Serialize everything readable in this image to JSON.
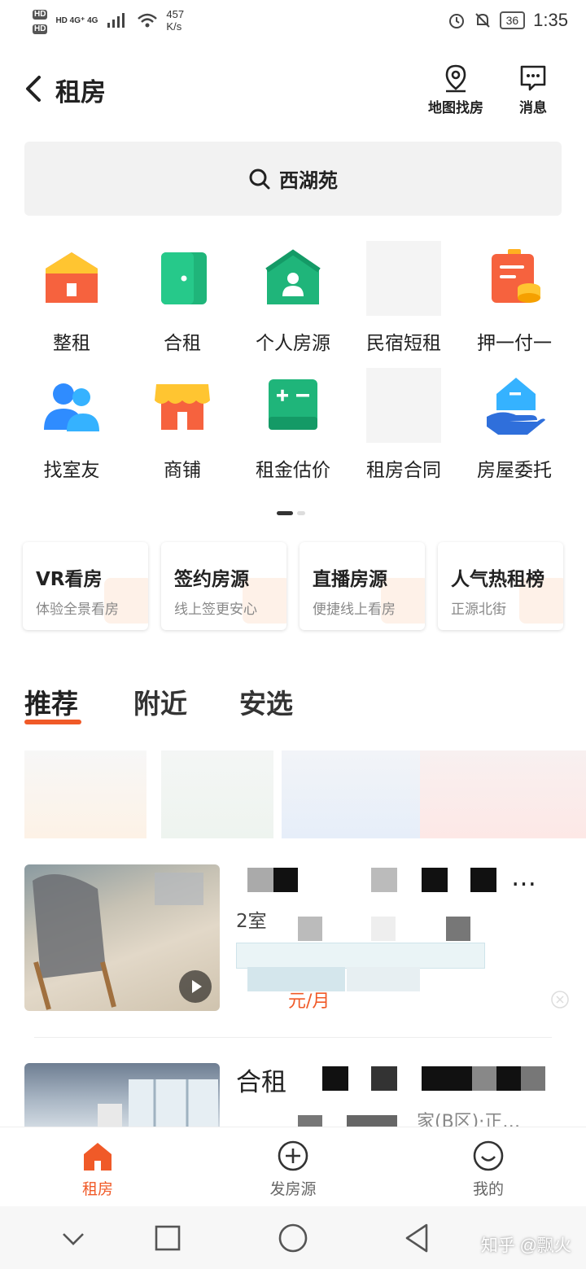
{
  "status_bar": {
    "left_text": "HD 4G⁺ 4G",
    "speed_value": "457",
    "speed_unit": "K/s",
    "battery": "36",
    "time": "1:35"
  },
  "header": {
    "title": "租房",
    "map_label": "地图找房",
    "message_label": "消息"
  },
  "search": {
    "text": "西湖苑"
  },
  "categories": [
    {
      "label": "整租",
      "icon": "house-icon"
    },
    {
      "label": "合租",
      "icon": "door-icon"
    },
    {
      "label": "个人房源",
      "icon": "person-house-icon"
    },
    {
      "label": "民宿短租",
      "icon": "placeholder-icon"
    },
    {
      "label": "押一付一",
      "icon": "bill-coins-icon"
    },
    {
      "label": "找室友",
      "icon": "roommates-icon"
    },
    {
      "label": "商铺",
      "icon": "shop-icon"
    },
    {
      "label": "租金估价",
      "icon": "calculator-icon"
    },
    {
      "label": "租房合同",
      "icon": "placeholder-icon"
    },
    {
      "label": "房屋委托",
      "icon": "hand-house-icon"
    }
  ],
  "features": [
    {
      "title": "VR看房",
      "subtitle": "体验全景看房"
    },
    {
      "title": "签约房源",
      "subtitle": "线上签更安心"
    },
    {
      "title": "直播房源",
      "subtitle": "便捷线上看房"
    },
    {
      "title": "人气热租榜",
      "subtitle": "正源北街"
    }
  ],
  "tabs": [
    "推荐",
    "附近",
    "安选"
  ],
  "listings": [
    {
      "title_fragment": "…",
      "rooms_fragment": "2室",
      "price_fragment": "元/月"
    },
    {
      "title_fragment": "合租",
      "address_fragment": "家(B区)·正…"
    }
  ],
  "bottom_nav": [
    {
      "label": "租房",
      "icon": "home-icon"
    },
    {
      "label": "发房源",
      "icon": "plus-circle-icon"
    },
    {
      "label": "我的",
      "icon": "smile-icon"
    }
  ],
  "watermark": "知乎 @飘火",
  "colors": {
    "accent": "#f05a28",
    "green": "#1fb57a",
    "search_bg": "#f2f2f2"
  }
}
